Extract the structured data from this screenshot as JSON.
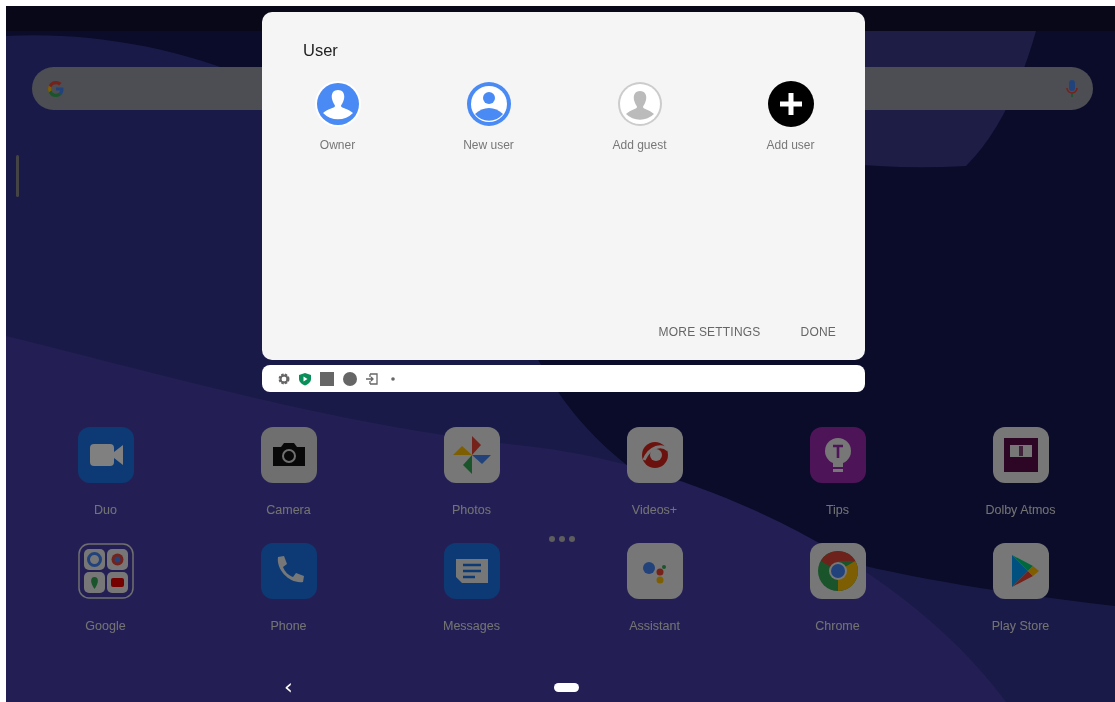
{
  "home": {
    "apps": [
      {
        "label": "Duo",
        "kind": "duo"
      },
      {
        "label": "Camera",
        "kind": "camera"
      },
      {
        "label": "Photos",
        "kind": "photos"
      },
      {
        "label": "Videos+",
        "kind": "videos"
      },
      {
        "label": "Tips",
        "kind": "tips"
      },
      {
        "label": "Dolby Atmos",
        "kind": "dolby"
      },
      {
        "label": "Google",
        "kind": "folder"
      },
      {
        "label": "Phone",
        "kind": "phone"
      },
      {
        "label": "Messages",
        "kind": "messages"
      },
      {
        "label": "Assistant",
        "kind": "assistant"
      },
      {
        "label": "Chrome",
        "kind": "chrome"
      },
      {
        "label": "Play Store",
        "kind": "play"
      }
    ],
    "nav": {
      "back": "‹"
    }
  },
  "dialog": {
    "title": "User",
    "users": [
      {
        "label": "Owner",
        "kind": "owner"
      },
      {
        "label": "New user",
        "kind": "new"
      },
      {
        "label": "Add guest",
        "kind": "guest"
      },
      {
        "label": "Add user",
        "kind": "add"
      }
    ],
    "buttons": [
      "MORE SETTINGS",
      "DONE"
    ]
  },
  "notification_strip": {
    "icons": [
      {
        "kind": "gear"
      },
      {
        "kind": "shield"
      },
      {
        "kind": "square"
      },
      {
        "kind": "circle"
      },
      {
        "kind": "exit"
      },
      {
        "kind": "dot"
      }
    ]
  }
}
